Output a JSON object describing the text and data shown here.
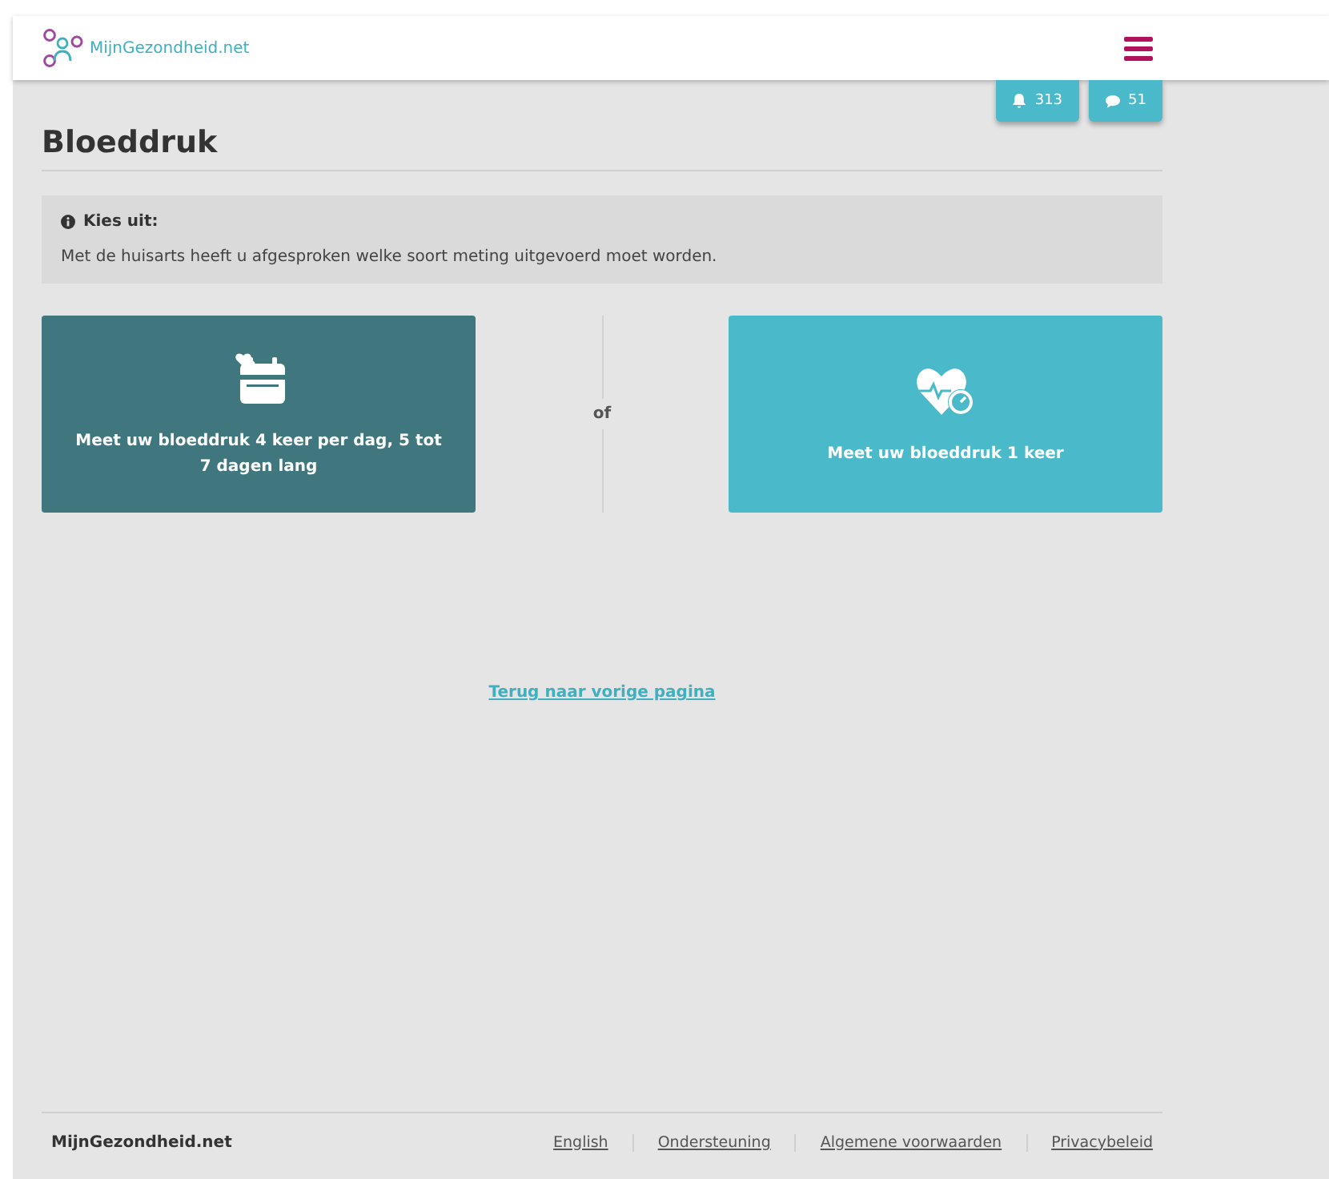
{
  "header": {
    "logo_text": "MijnGezondheid.net"
  },
  "badges": [
    {
      "kind": "notifications",
      "count": "313"
    },
    {
      "kind": "messages",
      "count": "51"
    }
  ],
  "title": "Bloeddruk",
  "notice": {
    "heading": "Kies uit:",
    "text": "Met de huisarts heeft u afgesproken welke soort meting uitgevoerd moet worden."
  },
  "options": [
    {
      "kind": "calendar",
      "label": "Meet uw bloeddruk 4 keer per dag, 5 tot 7 dagen lang",
      "selected": true
    },
    {
      "kind": "single",
      "label": "Meet uw bloeddruk 1 keer",
      "selected": false
    }
  ],
  "separator": "of",
  "back_link": "Terug naar vorige pagina",
  "footer": {
    "brand": "MijnGezondheid.net",
    "links": [
      "English",
      "Ondersteuning",
      "Algemene voorwaarden",
      "Privacybeleid"
    ]
  }
}
